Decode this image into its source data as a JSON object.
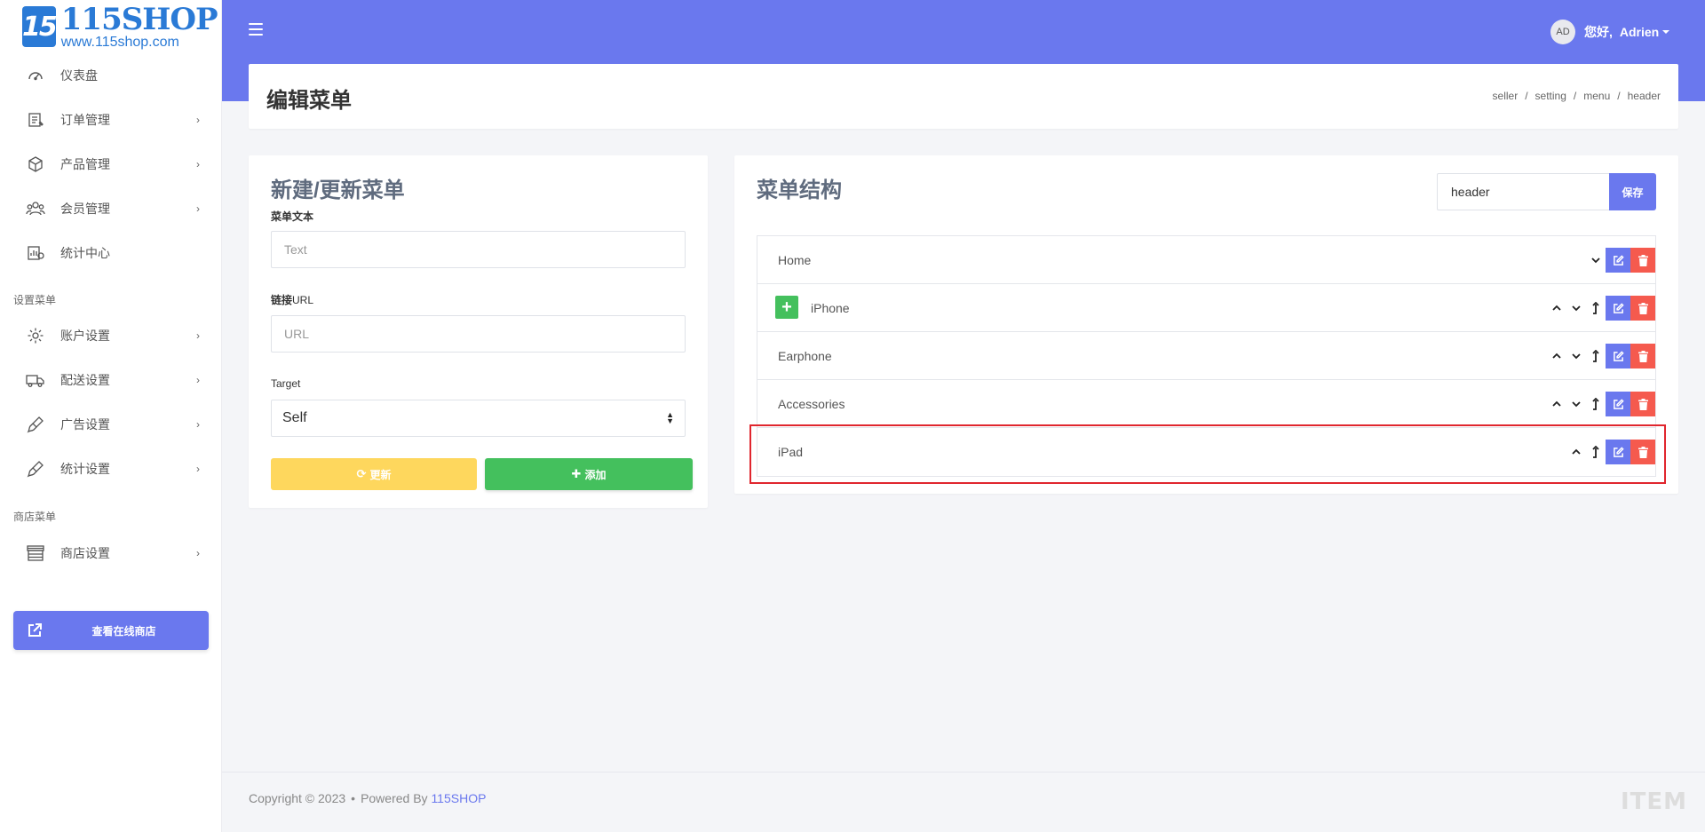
{
  "logo": {
    "mark": "15",
    "name": "115SHOP",
    "url": "www.115shop.com"
  },
  "sidebar": {
    "items": [
      {
        "label": "仪表盘",
        "icon": "dashboard-icon",
        "chevron": ""
      },
      {
        "label": "订单管理",
        "icon": "orders-icon",
        "chevron": "›"
      },
      {
        "label": "产品管理",
        "icon": "box-icon",
        "chevron": "›"
      },
      {
        "label": "会员管理",
        "icon": "users-icon",
        "chevron": "›"
      },
      {
        "label": "统计中心",
        "icon": "stats-icon",
        "chevron": ""
      }
    ],
    "section_settings": "设置菜单",
    "settings_items": [
      {
        "label": "账户设置",
        "icon": "gear-icon",
        "chevron": "›"
      },
      {
        "label": "配送设置",
        "icon": "truck-icon",
        "chevron": "›"
      },
      {
        "label": "广告设置",
        "icon": "brush-icon",
        "chevron": "›"
      },
      {
        "label": "统计设置",
        "icon": "brush-icon",
        "chevron": "›"
      }
    ],
    "section_shop": "商店菜单",
    "shop_items": [
      {
        "label": "商店设置",
        "icon": "store-icon",
        "chevron": "›"
      }
    ],
    "shop_button": "查看在线商店"
  },
  "header": {
    "avatar": "AD",
    "hello": "您好,",
    "username": "Adrien"
  },
  "page": {
    "title": "编辑菜单",
    "breadcrumb": [
      "seller",
      "setting",
      "menu",
      "header"
    ]
  },
  "form": {
    "title": "新建/更新菜单",
    "text_label": "菜单文本",
    "text_placeholder": "Text",
    "url_label_bold": "链接",
    "url_label_rest": "URL",
    "url_placeholder": "URL",
    "target_label": "Target",
    "target_value": "Self",
    "update_label": "更新",
    "add_label": "添加"
  },
  "menu": {
    "title": "菜单结构",
    "name_value": "header",
    "save_label": "保存",
    "items": [
      {
        "label": "Home",
        "up": false,
        "down": true,
        "nest": false,
        "add": false
      },
      {
        "label": "iPhone",
        "up": true,
        "down": true,
        "nest": true,
        "add": true
      },
      {
        "label": "Earphone",
        "up": true,
        "down": true,
        "nest": true,
        "add": false
      },
      {
        "label": "Accessories",
        "up": true,
        "down": true,
        "nest": true,
        "add": false
      },
      {
        "label": "iPad",
        "up": true,
        "down": false,
        "nest": true,
        "add": false
      }
    ]
  },
  "footer": {
    "copyright": "Copyright © 2023",
    "powered": "Powered By",
    "brand": "115SHOP",
    "watermark": "ITEM"
  },
  "colors": {
    "primary": "#6a78ee",
    "success": "#44c05d",
    "warning": "#fed75d",
    "danger": "#f55a4e",
    "highlight": "#e0262e"
  }
}
